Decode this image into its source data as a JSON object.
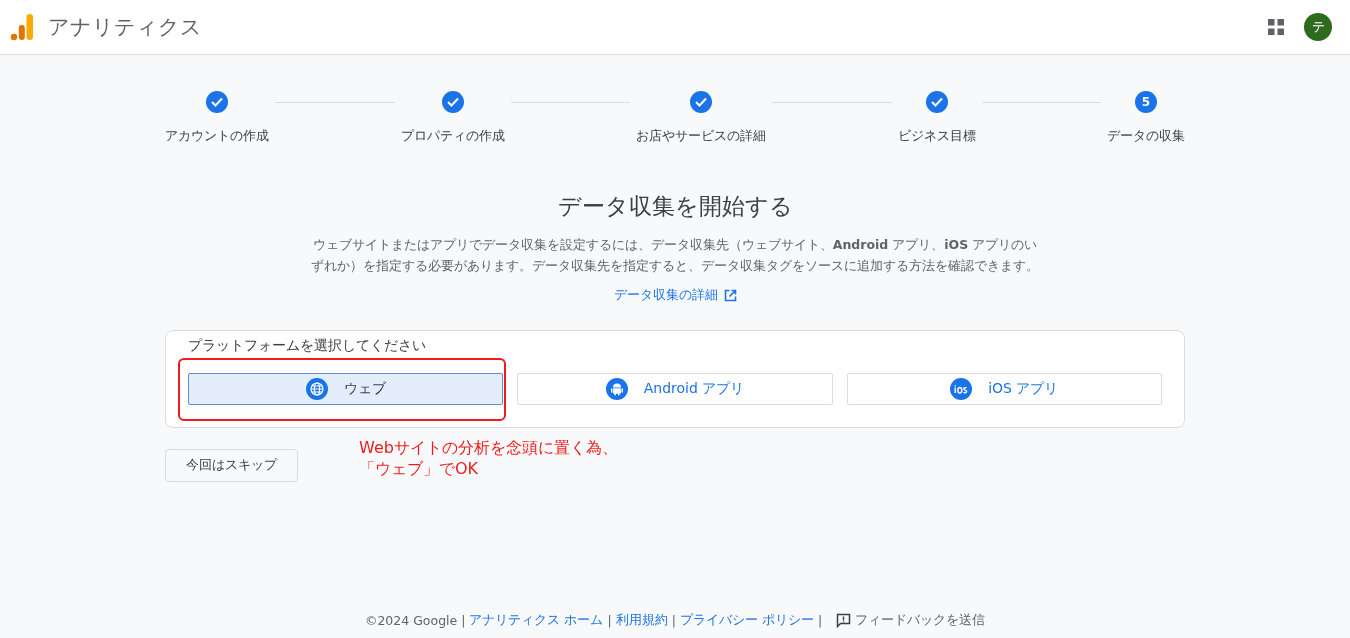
{
  "header": {
    "product_name": "アナリティクス",
    "avatar_initial": "テ"
  },
  "steps": [
    {
      "label": "アカウントの作成",
      "completed": true
    },
    {
      "label": "プロパティの作成",
      "completed": true
    },
    {
      "label": "お店やサービスの詳細",
      "completed": true
    },
    {
      "label": "ビジネス目標",
      "completed": true
    },
    {
      "label": "データの収集",
      "completed": false,
      "number": "5"
    }
  ],
  "title": "データ収集を開始する",
  "description": "ウェブサイトまたはアプリでデータ収集を設定するには、データ収集先（ウェブサイト、**Android** アプリ、**iOS** アプリのいずれか）を指定する必要があります。データ収集先を指定すると、データ収集タグをソースに追加する方法を確認できます。",
  "details_link": "データ収集の詳細",
  "platform_card": {
    "heading": "プラットフォームを選択してください",
    "platforms": [
      {
        "kind": "web",
        "label": "ウェブ",
        "selected": true
      },
      {
        "kind": "android",
        "label": "Android アプリ",
        "selected": false
      },
      {
        "kind": "ios",
        "label": "iOS アプリ",
        "selected": false
      }
    ]
  },
  "skip_button": "今回はスキップ",
  "annotation": {
    "lines": [
      "Webサイトの分析を念頭に置く為、",
      "「ウェブ」でOK"
    ]
  },
  "footer": {
    "items": [
      {
        "kind": "text",
        "text": "©2024 Google"
      },
      {
        "kind": "separator",
        "text": "|"
      },
      {
        "kind": "link",
        "text": "アナリティクス ホーム"
      },
      {
        "kind": "separator",
        "text": "|"
      },
      {
        "kind": "link",
        "text": "利用規約"
      },
      {
        "kind": "separator",
        "text": "|"
      },
      {
        "kind": "link",
        "text": "プライバシー ポリシー"
      },
      {
        "kind": "separator",
        "text": "|"
      },
      {
        "kind": "feedback",
        "text": "フィードバックを送信"
      }
    ]
  }
}
